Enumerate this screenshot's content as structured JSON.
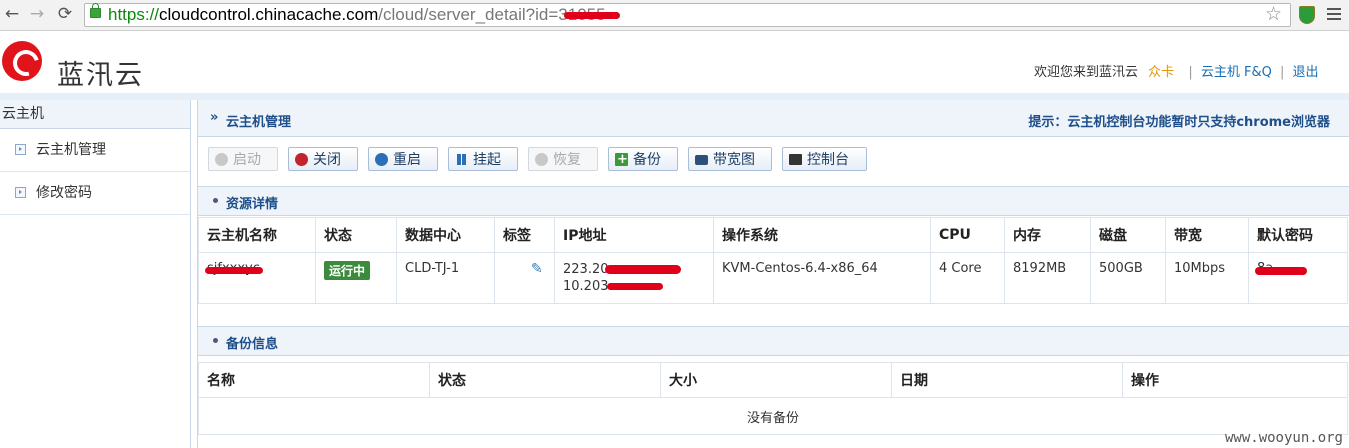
{
  "browser": {
    "url_scheme": "https://",
    "url_host": "cloudcontrol.chinacache.com",
    "url_path": "/cloud/server_detail?id=3",
    "url_redacted": "1055"
  },
  "header": {
    "brand": "蓝汛云",
    "welcome": "欢迎您来到蓝汛云",
    "user": "众卡",
    "faq_link": "云主机 F&Q",
    "logout_link": "退出"
  },
  "sidebar": {
    "title": "云主机",
    "items": [
      {
        "label": "云主机管理"
      },
      {
        "label": "修改密码"
      }
    ]
  },
  "main": {
    "title": "云主机管理",
    "tip": "提示：云主机控制台功能暂时只支持chrome浏览器",
    "toolbar": {
      "start": "启动",
      "shutdown": "关闭",
      "restart": "重启",
      "suspend": "挂起",
      "resume": "恢复",
      "backup": "备份",
      "bandwidth_chart": "带宽图",
      "console": "控制台"
    },
    "resource_section": "资源详情",
    "resource_columns": [
      "云主机名称",
      "状态",
      "数据中心",
      "标签",
      "IP地址",
      "操作系统",
      "CPU",
      "内存",
      "磁盘",
      "带宽",
      "默认密码"
    ],
    "resource_row": {
      "name": "sjfxxxyc",
      "status": "运行中",
      "datacenter": "CLD-TJ-1",
      "ip_public": "223.20",
      "ip_private": "10.203.",
      "os": "KVM-Centos-6.4-x86_64",
      "cpu": "4 Core",
      "memory": "8192MB",
      "disk": "500GB",
      "bandwidth": "10Mbps",
      "password": "8a"
    },
    "backup_section": "备份信息",
    "backup_columns": [
      "名称",
      "状态",
      "大小",
      "日期",
      "操作"
    ],
    "backup_empty": "没有备份"
  },
  "watermark": "www.wooyun.org",
  "colors": {
    "accent": "#1e4f8a",
    "brand_red": "#e1141b",
    "status_running": "#3c8a3c",
    "redaction": "#e0001a"
  }
}
